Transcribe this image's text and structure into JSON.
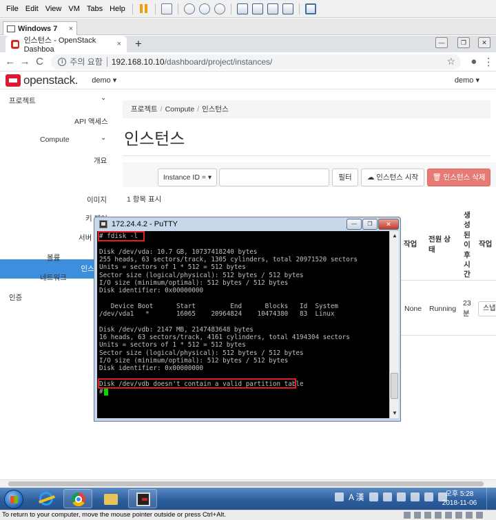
{
  "vmware": {
    "menu": [
      "File",
      "Edit",
      "View",
      "VM",
      "Tabs",
      "Help"
    ],
    "tab_label": "Windows 7",
    "tab_close": "×",
    "status_text": "To return to your computer, move the mouse pointer outside or press Ctrl+Alt."
  },
  "browser": {
    "tab_title": "인스턴스 - OpenStack Dashboa",
    "tab_close": "×",
    "new_tab": "+",
    "back": "←",
    "forward": "→",
    "reload": "C",
    "security_label": "주의 요함",
    "url_host": "192.168.10.10",
    "url_path": "/dashboard/project/instances/",
    "star": "☆",
    "account_icon": "●",
    "menu_icon": "⋮",
    "win_min": "—",
    "win_restore": "❐",
    "win_close": "✕"
  },
  "openstack": {
    "logo_text": "openstack.",
    "project_switcher": "demo ▾",
    "user_menu": "demo ▾",
    "sidebar": {
      "project": "프로젝트",
      "api_access": "API 액세스",
      "compute": "Compute",
      "overview": "개요",
      "instances": "인스턴스",
      "images": "이미지",
      "keypairs": "키 페어",
      "server_groups": "서버",
      "volumes": "볼륨",
      "network": "네트워크",
      "identity": "인증",
      "chevron": "⌄"
    },
    "breadcrumb": [
      "프로젝트",
      "Compute",
      "인스턴스"
    ],
    "breadcrumb_sep": "/",
    "page_title": "인스턴스",
    "filter_select": "Instance ID = ▾",
    "filter_button": "필터",
    "launch_button": "☁ 인스턴스 시작",
    "delete_button": "🗑 인스턴스 삭제",
    "count_text": "1 항목 표시",
    "columns": {
      "task": "작업",
      "power_state": "전원 상\n태",
      "age": "생\n성\n된\n이\n후\n시\n간",
      "actions": "작업"
    },
    "row": {
      "task": "None",
      "power_state": "Running",
      "age": "23\n분",
      "action_button": "스냅"
    }
  },
  "putty": {
    "title": "172.24.4.2 - PuTTY",
    "lines": [
      "# fdisk -l",
      "",
      "Disk /dev/vda: 10.7 GB, 10737418240 bytes",
      "255 heads, 63 sectors/track, 1305 cylinders, total 20971520 sectors",
      "Units = sectors of 1 * 512 = 512 bytes",
      "Sector size (logical/physical): 512 bytes / 512 bytes",
      "I/O size (minimum/optimal): 512 bytes / 512 bytes",
      "Disk identifier: 0x00000000",
      "",
      "   Device Boot      Start         End      Blocks   Id  System",
      "/dev/vda1   *       16065    20964824    10474380   83  Linux",
      "",
      "Disk /dev/vdb: 2147 MB, 2147483648 bytes",
      "16 heads, 63 sectors/track, 4161 cylinders, total 4194304 sectors",
      "Units = sectors of 1 * 512 = 512 bytes",
      "Sector size (logical/physical): 512 bytes / 512 bytes",
      "I/O size (minimum/optimal): 512 bytes / 512 bytes",
      "Disk identifier: 0x00000000",
      "",
      "Disk /dev/vdb doesn't contain a valid partition table",
      "#"
    ],
    "scroll_up": "▲",
    "scroll_down": "▼"
  },
  "taskbar": {
    "ime_text": "A 漢",
    "time": "오후 5:28",
    "date": "2018-11-06"
  }
}
